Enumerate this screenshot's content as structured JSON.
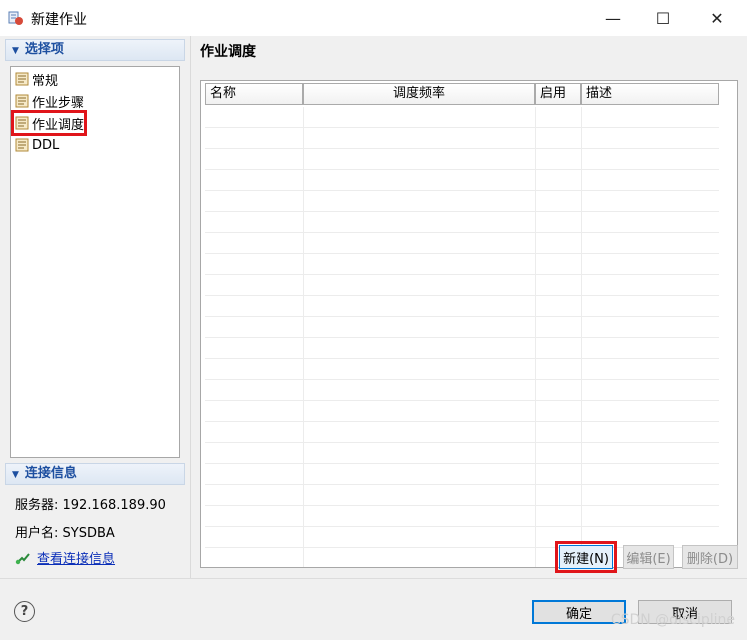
{
  "window": {
    "title": "新建作业",
    "min": "—",
    "max": "☐",
    "close": "✕"
  },
  "left": {
    "section1": "选择项",
    "tree": [
      "常规",
      "作业步骤",
      "作业调度",
      "DDL"
    ],
    "section2": "连接信息",
    "server": "服务器: 192.168.189.90",
    "user": "用户名: SYSDBA",
    "link": "查看连接信息"
  },
  "right": {
    "title": "作业调度",
    "columns": [
      "名称",
      "调度频率",
      "启用",
      "描述"
    ],
    "buttons": {
      "new": "新建(N)",
      "edit": "编辑(E)",
      "delete": "删除(D)"
    }
  },
  "footer": {
    "help": "?",
    "ok": "确定",
    "cancel": "取消",
    "watermark": "CSDN @discipline"
  },
  "colors": {
    "highlight": "#e0151a",
    "accent": "#0078d7",
    "link": "#0b2fb8"
  }
}
